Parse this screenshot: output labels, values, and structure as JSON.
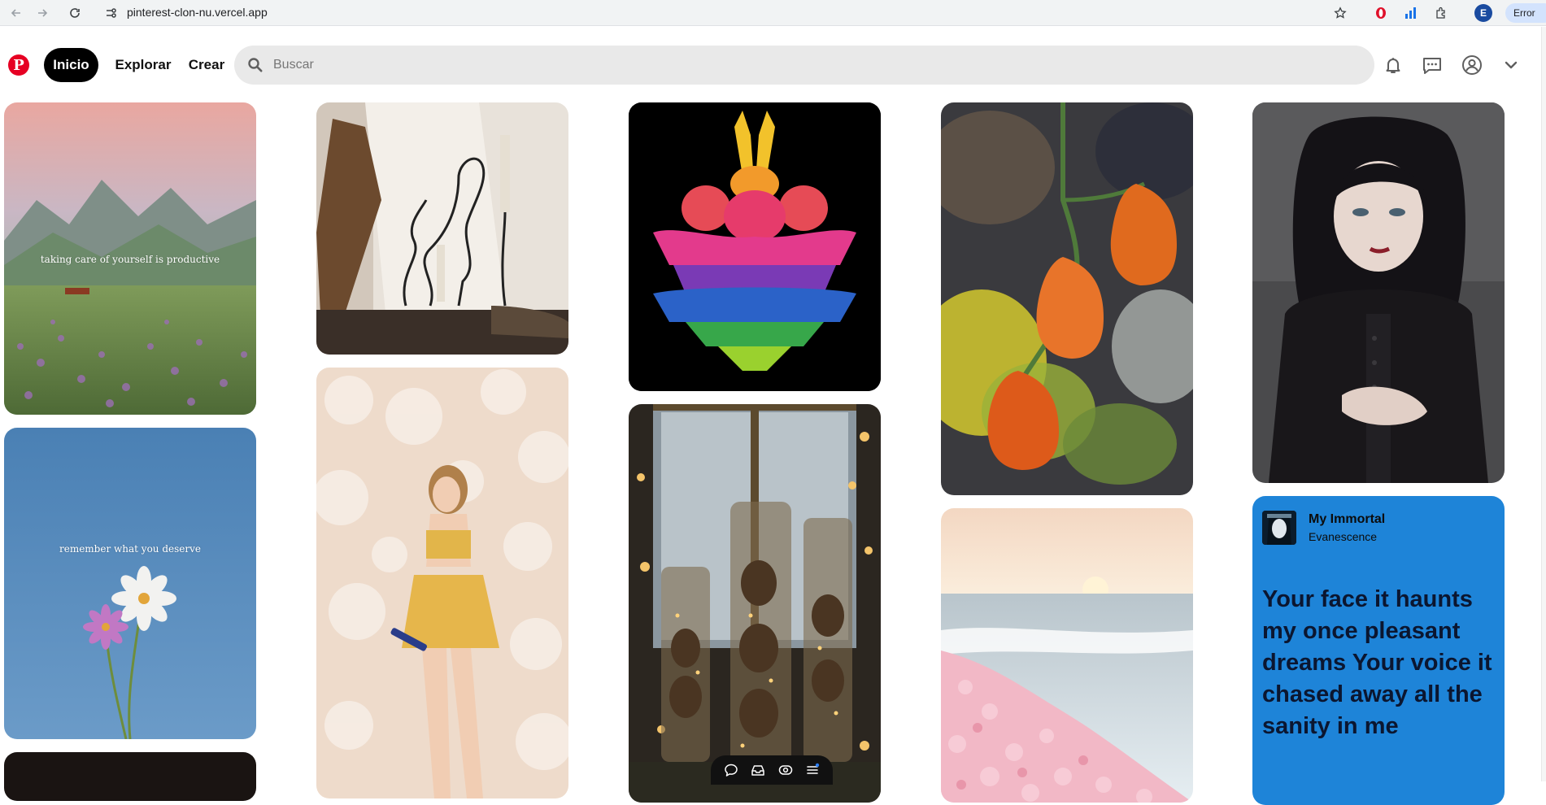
{
  "browser": {
    "url": "pinterest-clon-nu.vercel.app",
    "profile_initial": "E",
    "error_label": "Error"
  },
  "header": {
    "nav": {
      "home": "Inicio",
      "explore": "Explorar",
      "create": "Crear"
    },
    "search_placeholder": "Buscar"
  },
  "pins": {
    "meadow_caption": "taking care of yourself is productive",
    "sky_caption": "remember what you deserve",
    "lyrics_card": {
      "song": "My Immortal",
      "artist": "Evanescence",
      "lyrics": "Your face it haunts my once pleasant dreams Your voice it chased away all the sanity in me"
    }
  },
  "colors": {
    "brand": "#e60023",
    "active_nav": "#000000",
    "search_bg": "#e9e9e9",
    "lyrics_bg": "#1e84d8"
  },
  "icons": {
    "browser": [
      "back-icon",
      "forward-icon",
      "reload-icon",
      "site-info-icon",
      "star-icon",
      "extension-icon"
    ],
    "header": [
      "bell-icon",
      "chat-icon",
      "user-icon",
      "chevron-down-icon"
    ],
    "floating_toolbar": [
      "comment-icon",
      "inbox-icon",
      "eye-icon",
      "menu-icon"
    ]
  }
}
